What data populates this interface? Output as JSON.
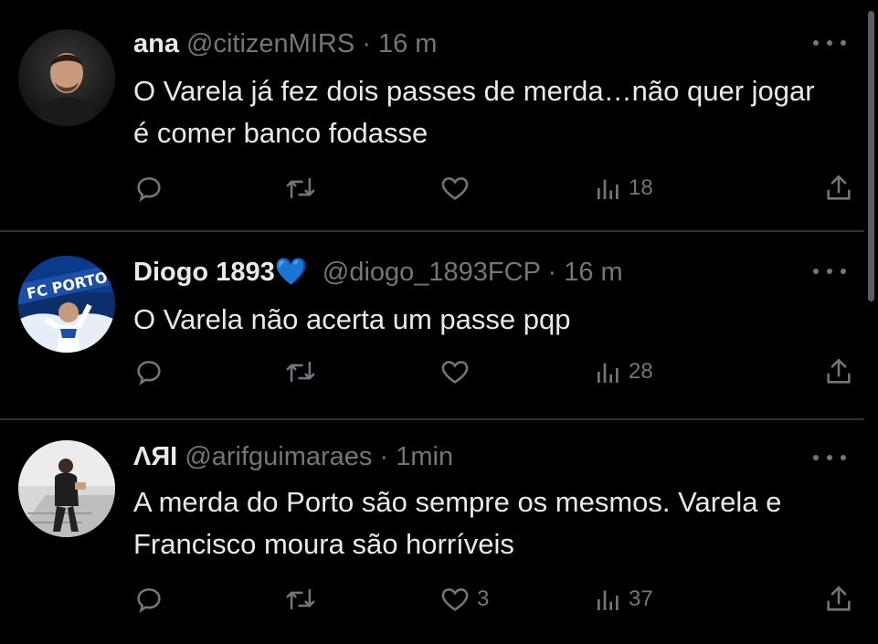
{
  "tweets": [
    {
      "name": "ana",
      "handle": "@citizenMIRS",
      "separator": "·",
      "time": "16 m",
      "verified_heart": "",
      "text": "O Varela já fez dois passes de merda…não quer jogar é comer banco fodasse",
      "reply_count": "",
      "retweet_count": "",
      "like_count": "",
      "view_count": "18"
    },
    {
      "name": "Diogo 1893",
      "handle": "@diogo_1893FCP",
      "separator": "·",
      "time": "16 m",
      "verified_heart": "💙",
      "avatar_text": "FC PORTO",
      "text": "O Varela não acerta um passe pqp",
      "reply_count": "",
      "retweet_count": "",
      "like_count": "",
      "view_count": "28"
    },
    {
      "name": "ΛЯI",
      "handle": "@arifguimaraes",
      "separator": "·",
      "time": "1min",
      "verified_heart": "",
      "text": "A merda do Porto são sempre os mesmos. Varela e Francisco moura são horríveis",
      "reply_count": "",
      "retweet_count": "",
      "like_count": "3",
      "view_count": "37"
    }
  ],
  "icons": {
    "reply": "reply-icon",
    "retweet": "retweet-icon",
    "like": "heart-outline-icon",
    "views": "views-bar-chart-icon",
    "share": "share-upload-icon",
    "more": "more-dots-icon"
  },
  "colors": {
    "background": "#000000",
    "text": "#e7e9ea",
    "muted": "#71767b",
    "divider": "#2f3336",
    "heart_emoji": "#1d9bf0"
  }
}
